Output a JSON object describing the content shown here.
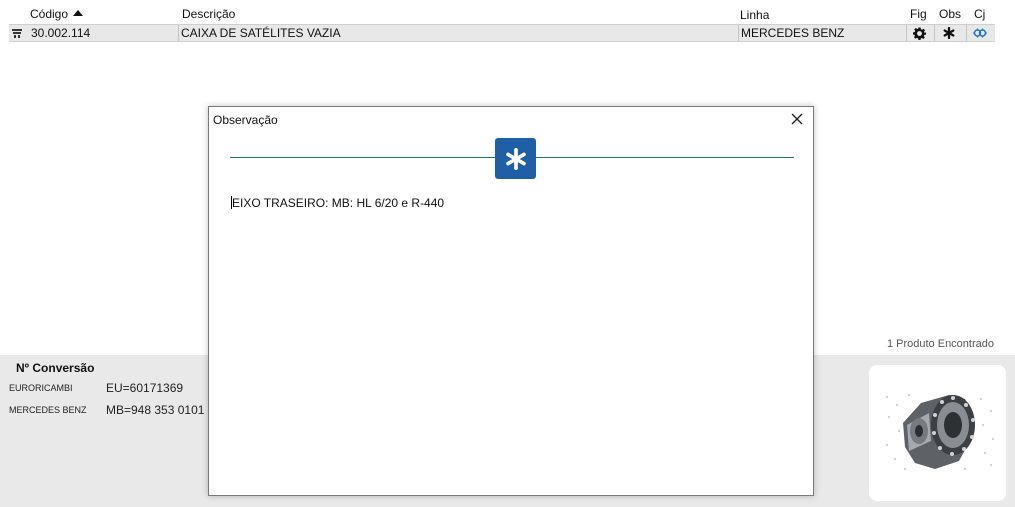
{
  "table": {
    "headers": {
      "codigo": "Código",
      "descricao": "Descrição",
      "linha": "Linha",
      "fig": "Fig",
      "obs": "Obs",
      "cj": "Cj"
    },
    "rows": [
      {
        "codigo": "30.002.114",
        "descricao": "CAIXA DE SATÉLITES VAZIA",
        "linha": "MERCEDES BENZ",
        "fig_icon": "gear-icon",
        "obs_icon": "asterisk-icon",
        "cj_icon": "gears-link-icon"
      }
    ]
  },
  "results": {
    "count_text": "1 Produto Encontrado"
  },
  "conversion": {
    "title": "Nº Conversão",
    "items": [
      {
        "brand": "EURORICAMBI",
        "code": "EU=60171369"
      },
      {
        "brand": "MERCEDES BENZ",
        "code": "MB=948 353 0101"
      }
    ]
  },
  "dialog": {
    "title": "Observação",
    "badge_icon": "asterisk-icon",
    "text": "EIXO TRASEIRO: MB: HL 6/20 e R-440",
    "close_icon": "close-icon"
  },
  "colors": {
    "row_bg": "#e8e8e8",
    "bottom_bg": "#e9e9e9",
    "badge": "#1f5fa5",
    "divider": "#1c7a63",
    "cj_icon": "#1f73c8"
  }
}
